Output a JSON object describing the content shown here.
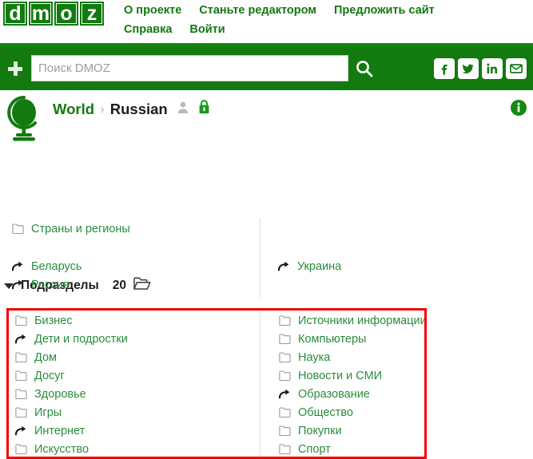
{
  "brand": {
    "logo_letters": [
      "d",
      "m",
      "o",
      "z"
    ],
    "green": "#137a10",
    "link_green": "#2a8c3c",
    "highlight_red": "#f40000"
  },
  "topnav": {
    "row1": [
      {
        "label": "О проекте",
        "name": "nav-about"
      },
      {
        "label": "Станьте редактором",
        "name": "nav-become-editor"
      },
      {
        "label": "Предложить сайт",
        "name": "nav-suggest-site"
      }
    ],
    "row2": [
      {
        "label": "Справка",
        "name": "nav-help"
      },
      {
        "label": "Войти",
        "name": "nav-login"
      }
    ]
  },
  "search": {
    "placeholder": "Поиск DMOZ",
    "value": "",
    "add_icon": "plus-icon",
    "submit_icon": "search-icon",
    "social": [
      {
        "name": "facebook-icon",
        "label": "f"
      },
      {
        "name": "twitter-icon",
        "label": "t"
      },
      {
        "name": "linkedin-icon",
        "label": "in"
      },
      {
        "name": "email-icon",
        "label": "mail"
      }
    ]
  },
  "breadcrumb": {
    "globe_icon": "globe-icon",
    "parent": "World",
    "separator": "›",
    "current": "Russian",
    "editor_icon": "editor-person-icon",
    "lock_icon": "category-lock-icon",
    "info_icon": "info-icon"
  },
  "subcategories_header": {
    "toggle_icon": "caret-down-icon",
    "title": "Подразделы",
    "count": "20",
    "folder_icon": "folder-open-icon"
  },
  "groups": {
    "countries": {
      "left": [
        {
          "label": "Страны и регионы",
          "icon": "folder-icon"
        }
      ],
      "right": []
    },
    "redirects": {
      "left": [
        {
          "label": "Беларусь",
          "icon": "redirect-arrow-icon"
        },
        {
          "label": "Россия",
          "icon": "redirect-arrow-icon"
        }
      ],
      "right": [
        {
          "label": "Украина",
          "icon": "redirect-arrow-icon"
        }
      ]
    },
    "main": {
      "left": [
        {
          "label": "Бизнес",
          "icon": "folder-icon"
        },
        {
          "label": "Дети и подростки",
          "icon": "redirect-arrow-icon"
        },
        {
          "label": "Дом",
          "icon": "folder-icon"
        },
        {
          "label": "Досуг",
          "icon": "folder-icon"
        },
        {
          "label": "Здоровье",
          "icon": "folder-icon"
        },
        {
          "label": "Игры",
          "icon": "folder-icon"
        },
        {
          "label": "Интернет",
          "icon": "redirect-arrow-icon"
        },
        {
          "label": "Искусство",
          "icon": "folder-icon"
        }
      ],
      "right": [
        {
          "label": "Источники информации",
          "icon": "folder-icon"
        },
        {
          "label": "Компьютеры",
          "icon": "folder-icon"
        },
        {
          "label": "Наука",
          "icon": "folder-icon"
        },
        {
          "label": "Новости и СМИ",
          "icon": "folder-icon"
        },
        {
          "label": "Образование",
          "icon": "redirect-arrow-icon"
        },
        {
          "label": "Общество",
          "icon": "folder-icon"
        },
        {
          "label": "Покупки",
          "icon": "folder-icon"
        },
        {
          "label": "Спорт",
          "icon": "folder-icon"
        }
      ]
    }
  }
}
